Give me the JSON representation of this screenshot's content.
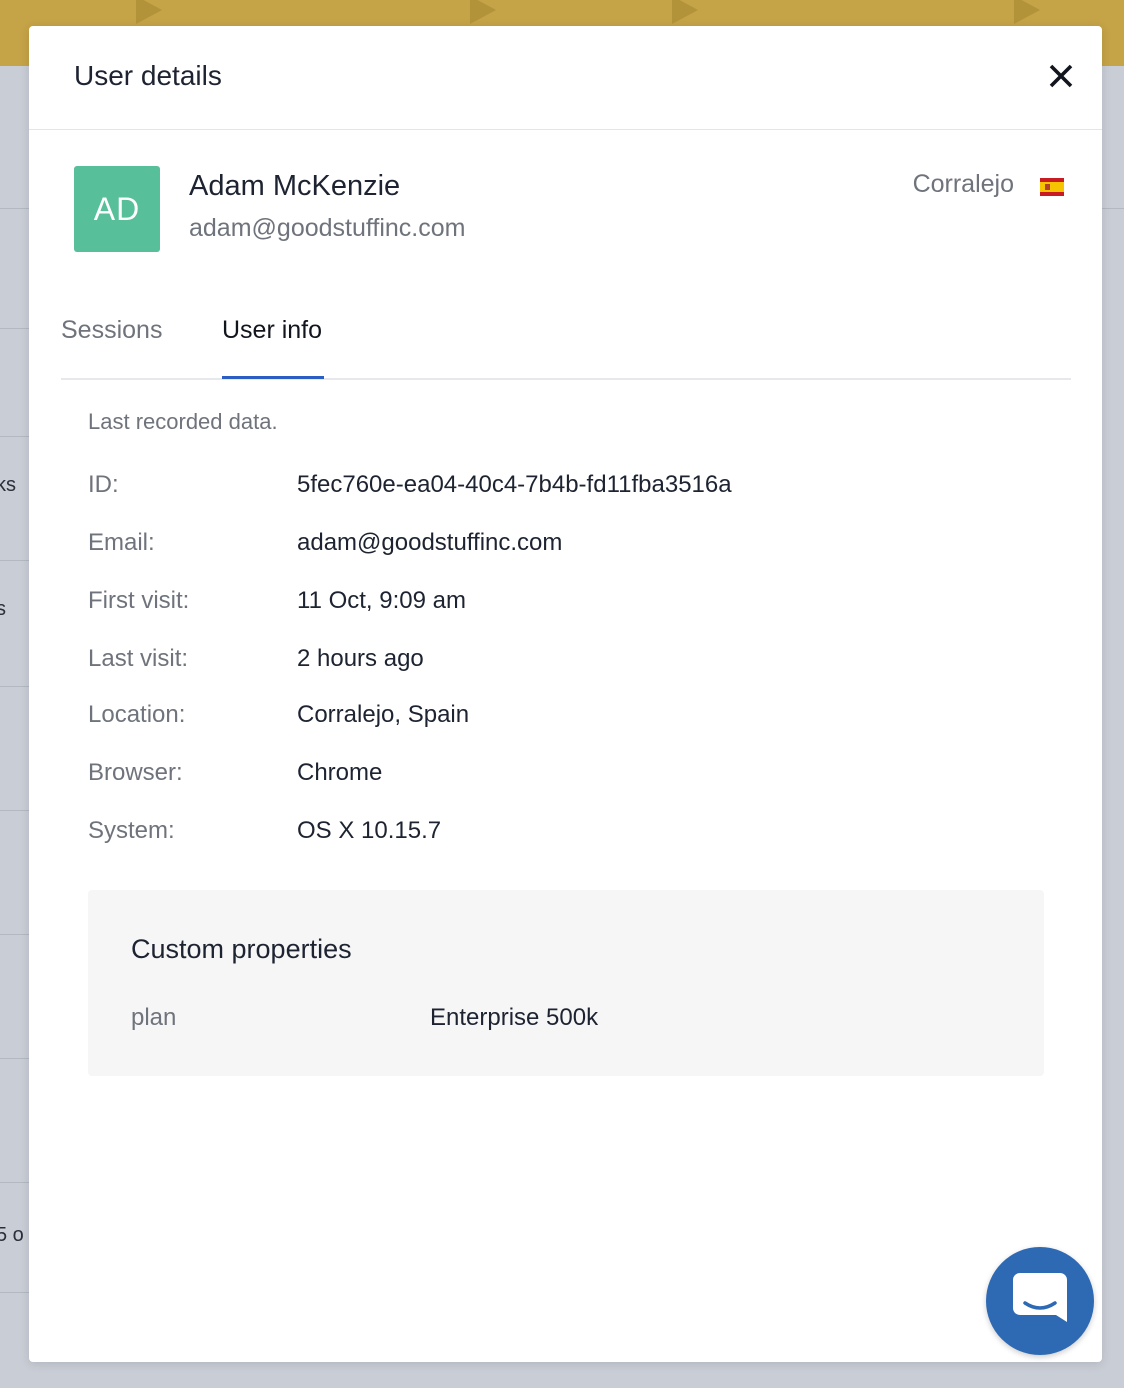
{
  "background": {
    "partial_texts": [
      "ks",
      "s",
      "5 o"
    ]
  },
  "modal": {
    "title": "User details"
  },
  "user": {
    "initials": "AD",
    "name": "Adam McKenzie",
    "email": "adam@goodstuffinc.com",
    "city": "Corralejo"
  },
  "tabs": [
    {
      "label": "Sessions",
      "active": false
    },
    {
      "label": "User info",
      "active": true
    }
  ],
  "user_info": {
    "note": "Last recorded data.",
    "rows": [
      {
        "label": "ID:",
        "value": "5fec760e-ea04-40c4-7b4b-fd11fba3516a"
      },
      {
        "label": "Email:",
        "value": "adam@goodstuffinc.com"
      },
      {
        "label": "First visit:",
        "value": "11 Oct, 9:09 am"
      },
      {
        "label": "Last visit:",
        "value": "2 hours ago"
      },
      {
        "label": "Location:",
        "value": "Corralejo, Spain"
      },
      {
        "label": "Browser:",
        "value": "Chrome"
      },
      {
        "label": "System:",
        "value": "OS X 10.15.7"
      }
    ]
  },
  "custom_properties": {
    "title": "Custom properties",
    "items": [
      {
        "key": "plan",
        "value": "Enterprise 500k"
      }
    ]
  },
  "icons": {
    "close": "close-icon",
    "flag": "spain-flag-icon",
    "chat": "chat-icon"
  },
  "colors": {
    "banner": "#c5a347",
    "avatar": "#57bf99",
    "tab_active_underline": "#2b5dc2",
    "chat_launcher": "#2e6ab4"
  }
}
